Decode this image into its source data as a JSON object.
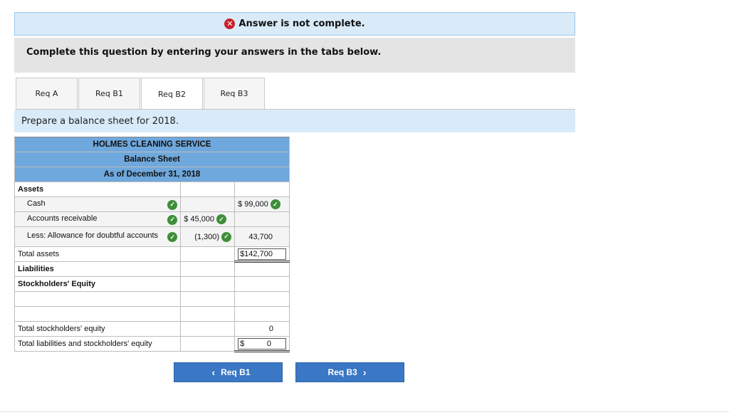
{
  "banner": {
    "icon": "x-circle-icon",
    "text": "Answer is not complete."
  },
  "instructions": "Complete this question by entering your answers in the tabs below.",
  "tabs": [
    {
      "label": "Req A",
      "active": false
    },
    {
      "label": "Req B1",
      "active": false
    },
    {
      "label": "Req B2",
      "active": true
    },
    {
      "label": "Req B3",
      "active": false
    }
  ],
  "prompt": "Prepare a balance sheet for 2018.",
  "sheet": {
    "company": "HOLMES CLEANING SERVICE",
    "title": "Balance Sheet",
    "date": "As of December 31, 2018",
    "assets_label": "Assets",
    "cash_label": "Cash",
    "cash_value": "$ 99,000",
    "ar_label": "Accounts receivable",
    "ar_value": "$ 45,000",
    "allowance_label": "Less: Allowance for doubtful accounts",
    "allowance_value": "(1,300)",
    "net_ar_value": "43,700",
    "total_assets_label": "Total assets",
    "total_assets_value": "$142,700",
    "liabilities_label": "Liabilities",
    "equity_label": "Stockholders' Equity",
    "total_equity_label": "Total stockholders' equity",
    "total_equity_value": "0",
    "total_le_label": "Total liabilities and stockholders' equity",
    "total_le_currency": "$",
    "total_le_value": "0"
  },
  "nav": {
    "prev_label": "Req B1",
    "next_label": "Req B3"
  },
  "colors": {
    "header_blue": "#6fa8dc",
    "banner_bg": "#d9ebf9",
    "check_green": "#3e8e3a",
    "error_red": "#cc1f2d",
    "button_blue": "#3a77c4"
  }
}
